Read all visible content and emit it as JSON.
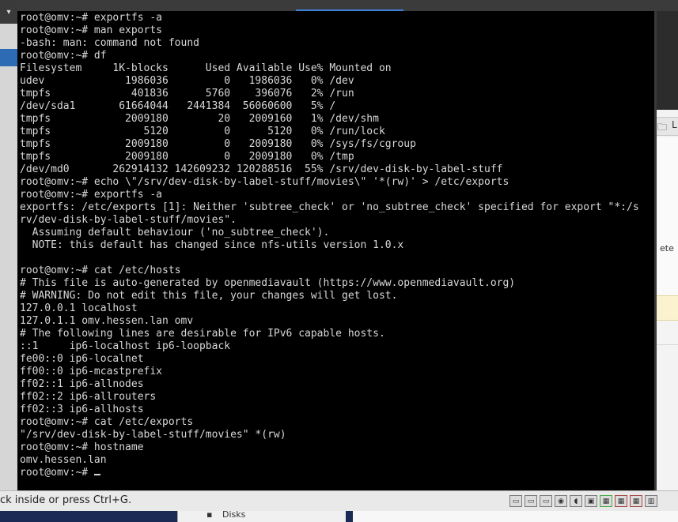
{
  "terminal": {
    "lines": [
      "root@omv:~# exportfs -a",
      "root@omv:~# man exports",
      "-bash: man: command not found",
      "root@omv:~# df",
      "Filesystem     1K-blocks      Used Available Use% Mounted on",
      "udev             1986036         0   1986036   0% /dev",
      "tmpfs             401836      5760    396076   2% /run",
      "/dev/sda1       61664044   2441384  56060600   5% /",
      "tmpfs            2009180        20   2009160   1% /dev/shm",
      "tmpfs               5120         0      5120   0% /run/lock",
      "tmpfs            2009180         0   2009180   0% /sys/fs/cgroup",
      "tmpfs            2009180         0   2009180   0% /tmp",
      "/dev/md0       262914132 142609232 120288516  55% /srv/dev-disk-by-label-stuff",
      "root@omv:~# echo \\\"/srv/dev-disk-by-label-stuff/movies\\\" '*(rw)' > /etc/exports",
      "root@omv:~# exportfs -a",
      "exportfs: /etc/exports [1]: Neither 'subtree_check' or 'no_subtree_check' specified for export \"*:/s",
      "rv/dev-disk-by-label-stuff/movies\".",
      "  Assuming default behaviour ('no_subtree_check').",
      "  NOTE: this default has changed since nfs-utils version 1.0.x",
      "",
      "root@omv:~# cat /etc/hosts",
      "# This file is auto-generated by openmediavault (https://www.openmediavault.org)",
      "# WARNING: Do not edit this file, your changes will get lost.",
      "127.0.0.1 localhost",
      "127.0.1.1 omv.hessen.lan omv",
      "# The following lines are desirable for IPv6 capable hosts.",
      "::1     ip6-localhost ip6-loopback",
      "fe00::0 ip6-localnet",
      "ff00::0 ip6-mcastprefix",
      "ff02::1 ip6-allnodes",
      "ff02::2 ip6-allrouters",
      "ff02::3 ip6-allhosts",
      "root@omv:~# cat /etc/exports",
      "\"/srv/dev-disk-by-label-stuff/movies\" *(rw)",
      "root@omv:~# hostname",
      "omv.hessen.lan"
    ],
    "prompt": "root@omv:~# "
  },
  "statusbar": {
    "message": "ck inside or press Ctrl+G.",
    "tray_icons": [
      "hdd-icon",
      "network-icon",
      "usb-icon",
      "cd-icon",
      "audio-icon",
      "display-icon",
      "shared-folder-icon",
      "capture-icon",
      "network-disconnected-icon",
      "keyboard-icon"
    ]
  },
  "background": {
    "right_label": "L",
    "right_label2": "ete",
    "bottom_label": "Disks"
  },
  "colors": {
    "terminal_bg": "#000000",
    "terminal_fg": "#d8d8d8",
    "statusbar_bg": "#e9e9e9",
    "accent": "#3c7fd6"
  }
}
